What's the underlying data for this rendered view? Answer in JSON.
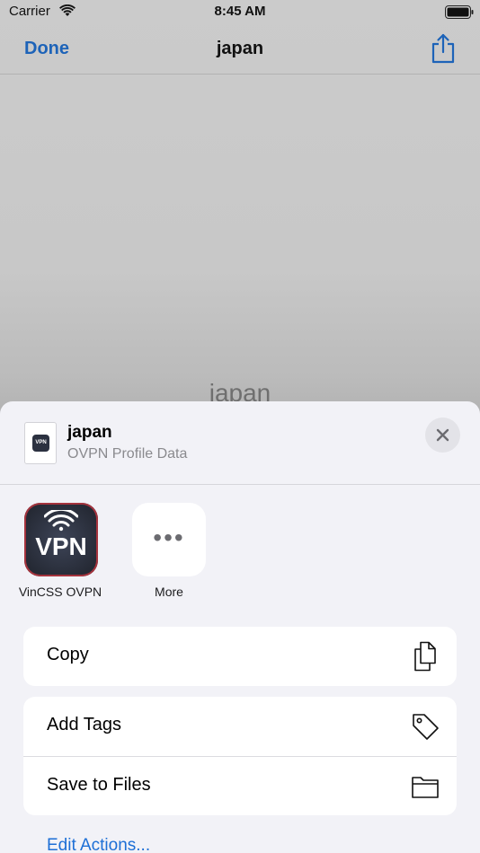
{
  "status_bar": {
    "carrier": "Carrier",
    "time": "8:45 AM"
  },
  "nav": {
    "done_label": "Done",
    "title": "japan"
  },
  "preview": {
    "name": "japan"
  },
  "sheet": {
    "file_name": "japan",
    "file_kind": "OVPN Profile Data",
    "thumb_badge": "VPN",
    "apps": [
      {
        "label": "VinCSS OVPN",
        "icon_text": "VPN",
        "icon": "vpn-app-icon"
      },
      {
        "label": "More",
        "icon_text": "•••",
        "icon": "more-icon"
      }
    ],
    "actions_group1": [
      {
        "label": "Copy",
        "icon": "copy-icon"
      }
    ],
    "actions_group2": [
      {
        "label": "Add Tags",
        "icon": "tag-icon"
      },
      {
        "label": "Save to Files",
        "icon": "folder-icon"
      }
    ],
    "edit_actions": "Edit Actions..."
  },
  "colors": {
    "accent": "#1d63b8",
    "link": "#1d6fd6",
    "sheet_bg": "#f2f2f7",
    "vpn_border": "#a5333d"
  }
}
